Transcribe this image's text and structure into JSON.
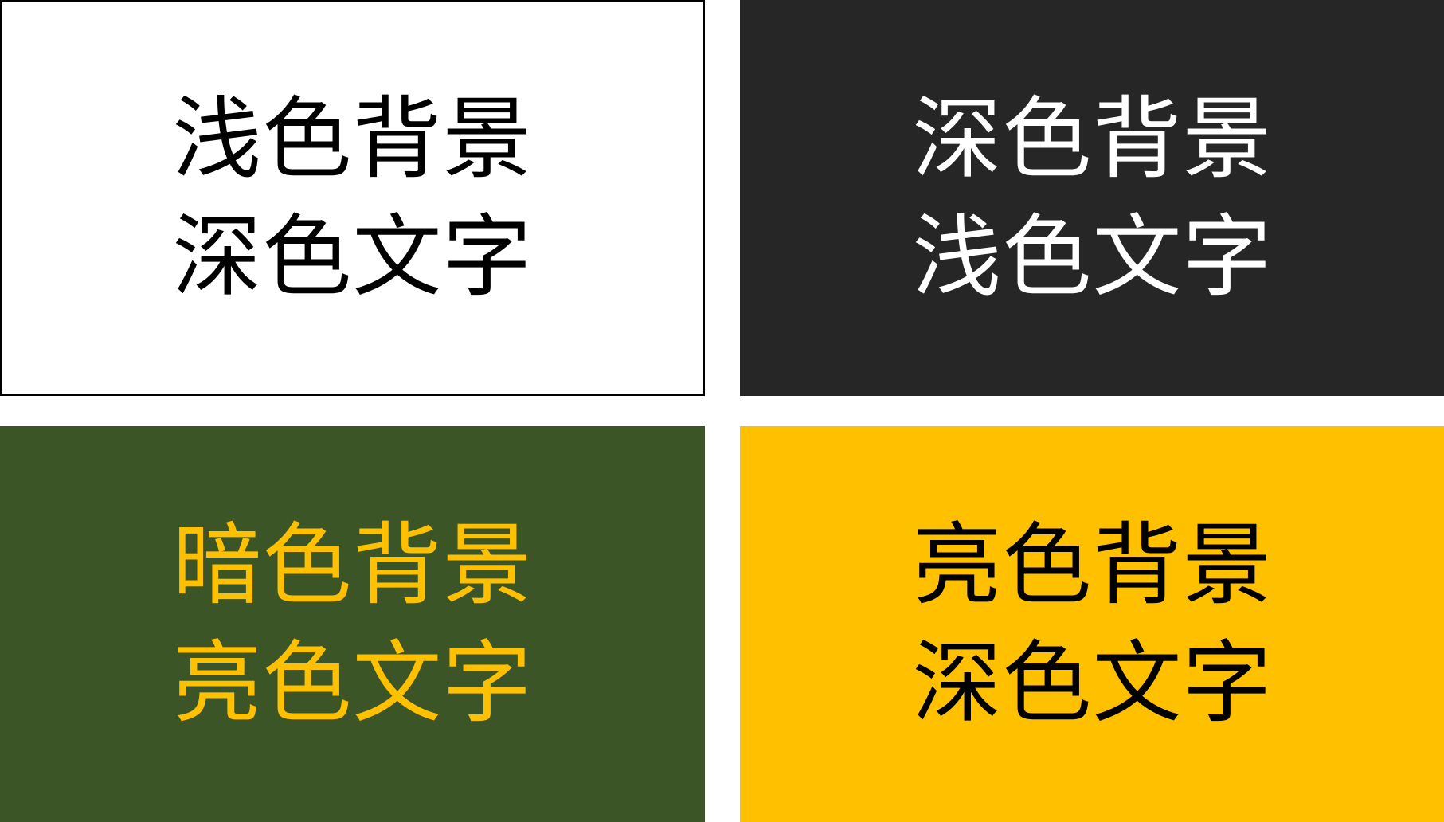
{
  "panels": [
    {
      "line1": "浅色背景",
      "line2": "深色文字",
      "bg": "#ffffff",
      "fg": "#000000"
    },
    {
      "line1": "深色背景",
      "line2": "浅色文字",
      "bg": "#262626",
      "fg": "#ffffff"
    },
    {
      "line1": "暗色背景",
      "line2": "亮色文字",
      "bg": "#3b5526",
      "fg": "#ffc000"
    },
    {
      "line1": "亮色背景",
      "line2": "深色文字",
      "bg": "#ffc000",
      "fg": "#000000"
    }
  ]
}
